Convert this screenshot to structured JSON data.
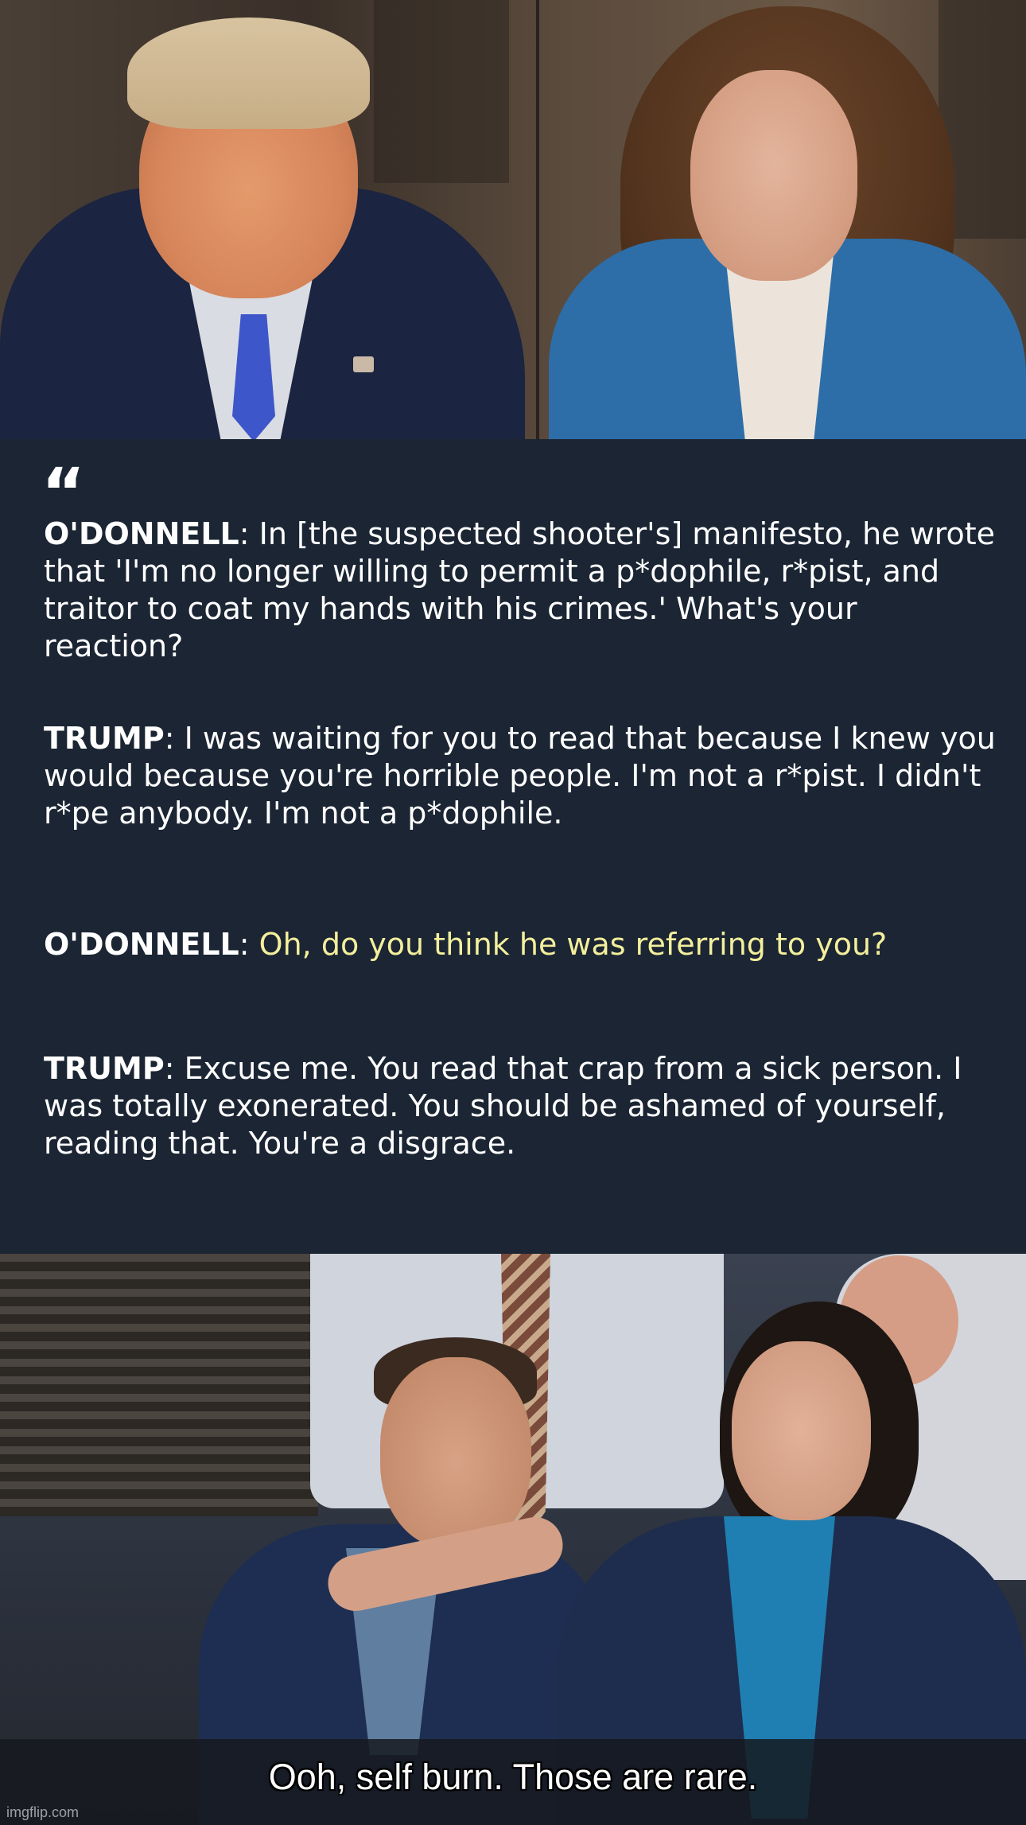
{
  "quote": {
    "mark": "“",
    "exchanges": [
      {
        "speaker": "O'DONNELL",
        "text": ": In [the suspected shooter's] manifesto, he wrote that 'I'm no longer willing to permit a p*dophile, r*pist, and traitor to coat my hands with his crimes.' What's your reaction?",
        "highlighted": ""
      },
      {
        "speaker": "TRUMP",
        "text": ": I was waiting for you to read that because I knew you would because you're horrible people. I'm not a r*pist. I didn't r*pe anybody. I'm not a p*dophile.",
        "highlighted": ""
      },
      {
        "speaker": "O'DONNELL",
        "text": ": ",
        "highlighted": "Oh, do you think he was referring to you?"
      },
      {
        "speaker": "TRUMP",
        "text": ": Excuse me. You read that crap from a sick person. I was totally exonerated. You should be ashamed of yourself, reading that. You're a disgrace.",
        "highlighted": ""
      }
    ],
    "highlight_color": "#f3ef9c",
    "background_color": "#1b2533"
  },
  "meme": {
    "caption": "Ooh, self burn. Those are rare.",
    "watermark": "imgflip.com"
  }
}
